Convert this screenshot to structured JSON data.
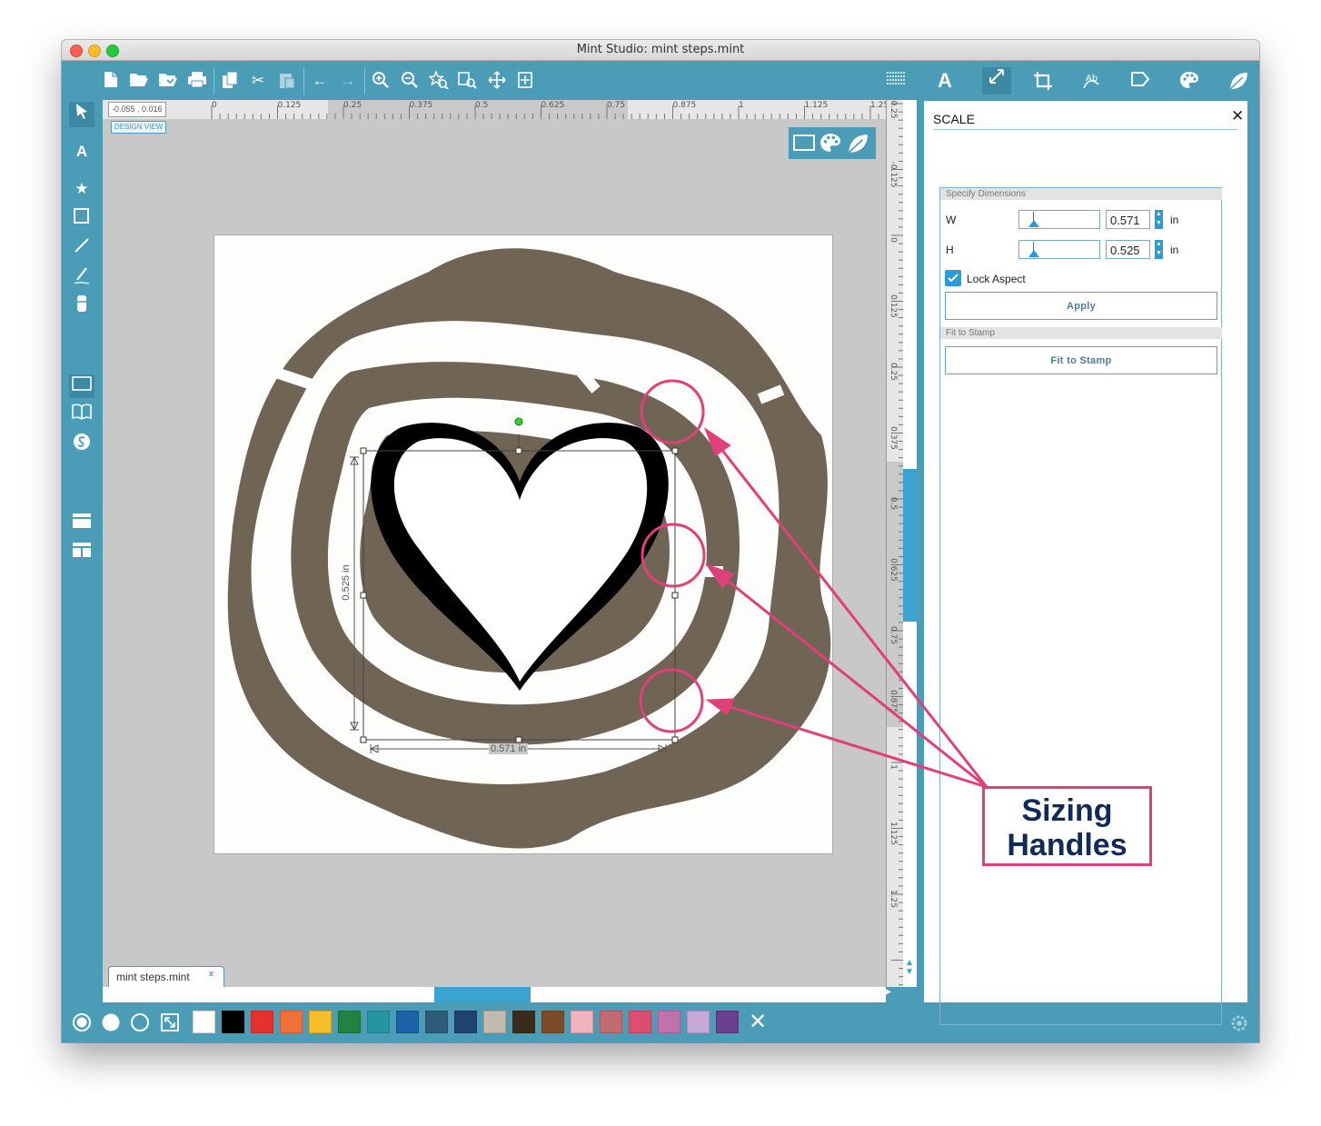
{
  "window": {
    "title": "Mint Studio: mint steps.mint"
  },
  "ruler": {
    "coords": "-0.055 , 0.016",
    "top_labels": [
      "0",
      "0.125",
      "0.25",
      "0.375",
      "0.5",
      "0.625",
      "0.75",
      "0.875",
      "1",
      "1.125",
      "1.25"
    ],
    "right_labels": [
      "-0.25",
      "-0.125",
      "0",
      "0.125",
      "0.25",
      "0.375",
      "0.5",
      "0.625",
      "0.75",
      "0.875",
      "1",
      "1.125",
      "1.25"
    ]
  },
  "canvas": {
    "view_label": "DESIGN VIEW",
    "height_dim": "0.525 in",
    "width_dim": "0.571 in",
    "tab_name": "mint steps.mint",
    "tab_close": "x",
    "stamp_color": "#706555"
  },
  "annotation": {
    "line1": "Sizing",
    "line2": "Handles",
    "color": "#e0407a"
  },
  "panel": {
    "title": "SCALE",
    "close": "✕",
    "specify_header": "Specify Dimensions",
    "w_label": "W",
    "w_value": "0.571",
    "w_unit": "in",
    "h_label": "H",
    "h_value": "0.525",
    "h_unit": "in",
    "lock_label": "Lock Aspect",
    "lock_checked": true,
    "apply_label": "Apply",
    "fit_header": "Fit to Stamp",
    "fit_label": "Fit to Stamp"
  },
  "palette": [
    "#ffffff",
    "#000000",
    "#e5322d",
    "#f07037",
    "#f6bf27",
    "#228244",
    "#24969f",
    "#1c63a8",
    "#2b5d78",
    "#1d4470",
    "#c3bab0",
    "#3a2b1f",
    "#7d4a2b",
    "#f2b3bf",
    "#c06a72",
    "#dd4d71",
    "#c272ab",
    "#c7a9d8",
    "#6a3f8e"
  ]
}
